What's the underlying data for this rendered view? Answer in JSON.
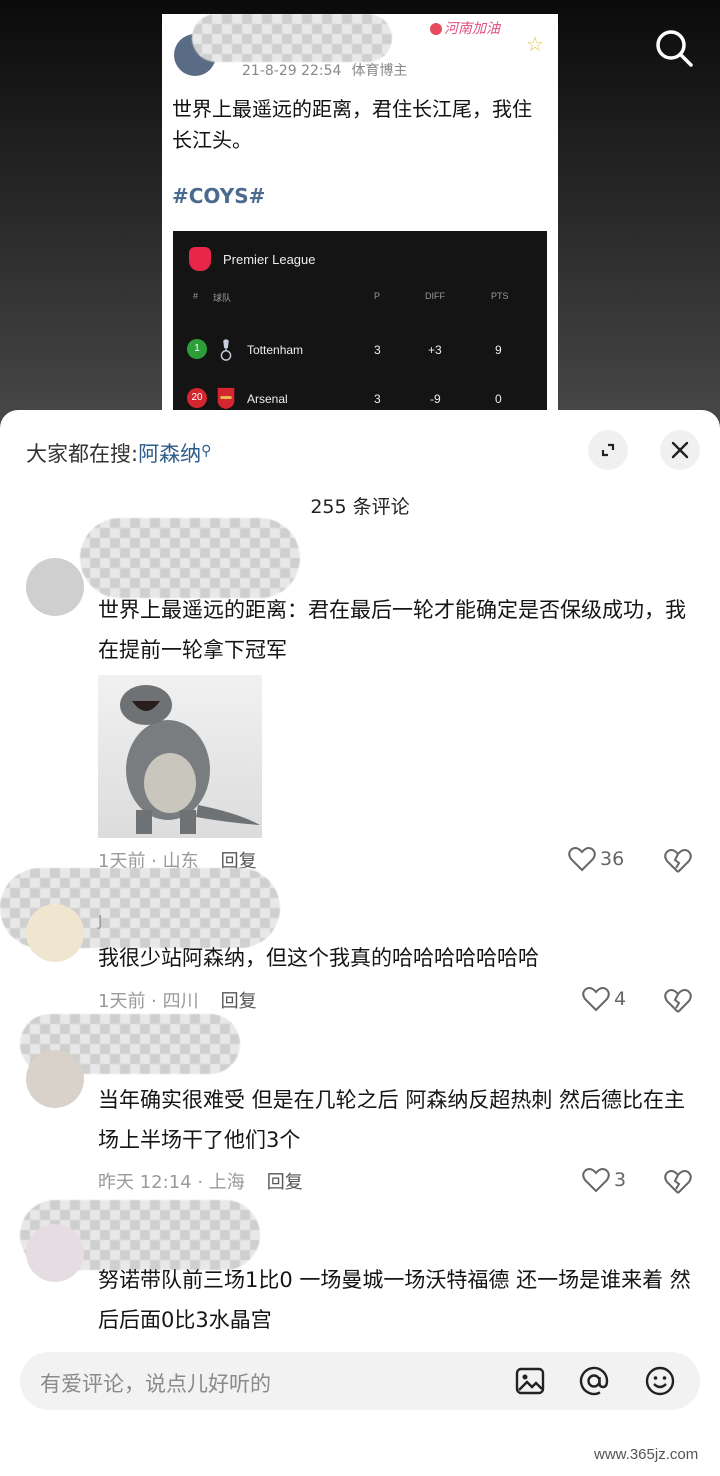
{
  "post": {
    "date": "21-8-29 22:54",
    "source": "体育博主",
    "logo_text": "河南加油",
    "text": "世界上最遥远的距离，君住长江尾，我住长江头。",
    "tag": "#COYS#",
    "table": {
      "league": "Premier League",
      "headers": {
        "pos": "#",
        "team": "球队",
        "played": "P",
        "diff": "DIFF",
        "points": "PTS"
      },
      "rows": [
        {
          "pos": "1",
          "team": "Tottenham",
          "played": "3",
          "diff": "+3",
          "points": "9",
          "badge_color": "#2e9e3a"
        },
        {
          "pos": "20",
          "team": "Arsenal",
          "played": "3",
          "diff": "-9",
          "points": "0",
          "badge_color": "#d3262f"
        }
      ]
    }
  },
  "sheet": {
    "search_prefix": "大家都在搜:",
    "search_keyword": "阿森纳",
    "comment_count": "255 条评论"
  },
  "comments": [
    {
      "text": "世界上最遥远的距离：君在最后一轮才能确定是否保级成功，我在提前一轮拿下冠军",
      "time_loc": "1天前 · 山东",
      "reply": "回复",
      "likes": "36"
    },
    {
      "name": "J",
      "text": "我很少站阿森纳，但这个我真的哈哈哈哈哈哈哈",
      "time_loc": "1天前 · 四川",
      "reply": "回复",
      "likes": "4"
    },
    {
      "text": "当年确实很难受 但是在几轮之后 阿森纳反超热刺 然后德比在主场上半场干了他们3个",
      "time_loc": "昨天 12:14 · 上海",
      "reply": "回复",
      "likes": "3"
    },
    {
      "text": "努诺带队前三场1比0 一场曼城一场沃特福德 还一场是谁来着  然后后面0比3水晶宫"
    }
  ],
  "input": {
    "placeholder": "有爱评论，说点儿好听的"
  },
  "watermark": "www.365jz.com",
  "colors": {
    "accent_link": "#2d5d8a",
    "tag": "#4a6a8e"
  }
}
